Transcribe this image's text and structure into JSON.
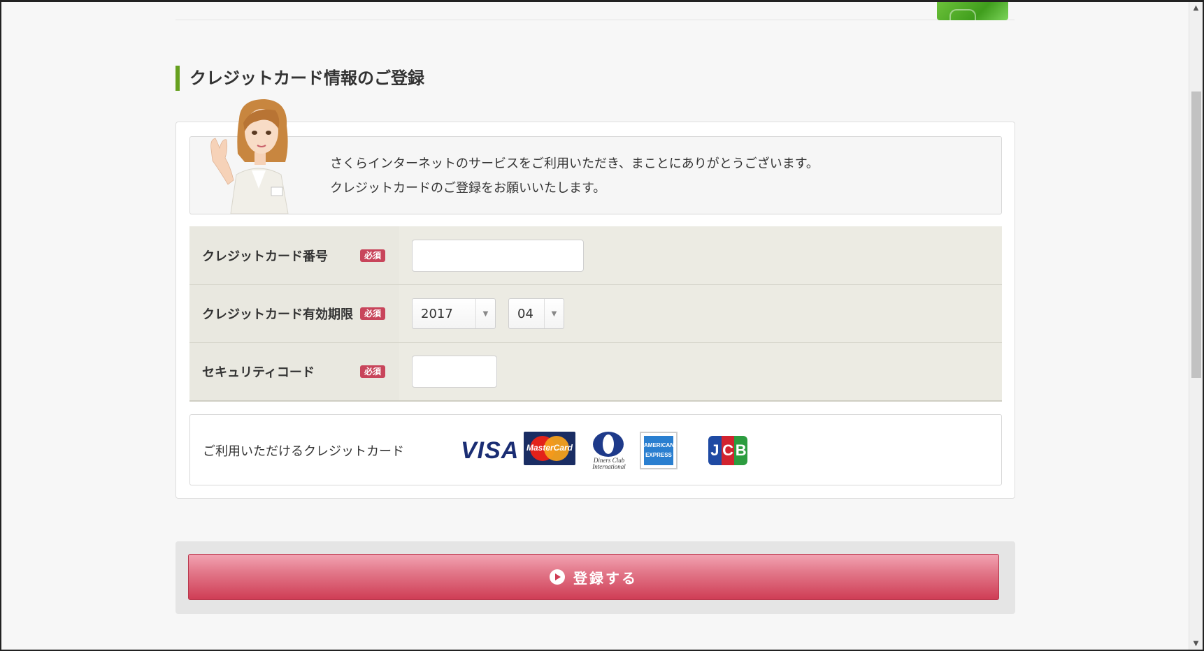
{
  "heading": "クレジットカード情報のご登録",
  "intro": {
    "line1": "さくらインターネットのサービスをご利用いただき、まことにありがとうございます。",
    "line2": "クレジットカードのご登録をお願いいたします。"
  },
  "form": {
    "required_badge": "必須",
    "card_number": {
      "label": "クレジットカード番号",
      "value": "",
      "placeholder": ""
    },
    "expiry": {
      "label": "クレジットカード有効期限",
      "year": "2017",
      "month": "04"
    },
    "security_code": {
      "label": "セキュリティコード",
      "value": "",
      "placeholder": ""
    }
  },
  "cards": {
    "label": "ご利用いただけるクレジットカード",
    "brands": {
      "visa": "VISA",
      "mastercard": "MasterCard",
      "diners": "Diners Club International",
      "amex": "AMERICAN EXPRESS",
      "jcb_j": "J",
      "jcb_c": "C",
      "jcb_b": "B"
    }
  },
  "submit": {
    "label": "登録する"
  },
  "colors": {
    "accent_green": "#66a01f",
    "required_red": "#c8455b",
    "button_red": "#cf3d55"
  }
}
